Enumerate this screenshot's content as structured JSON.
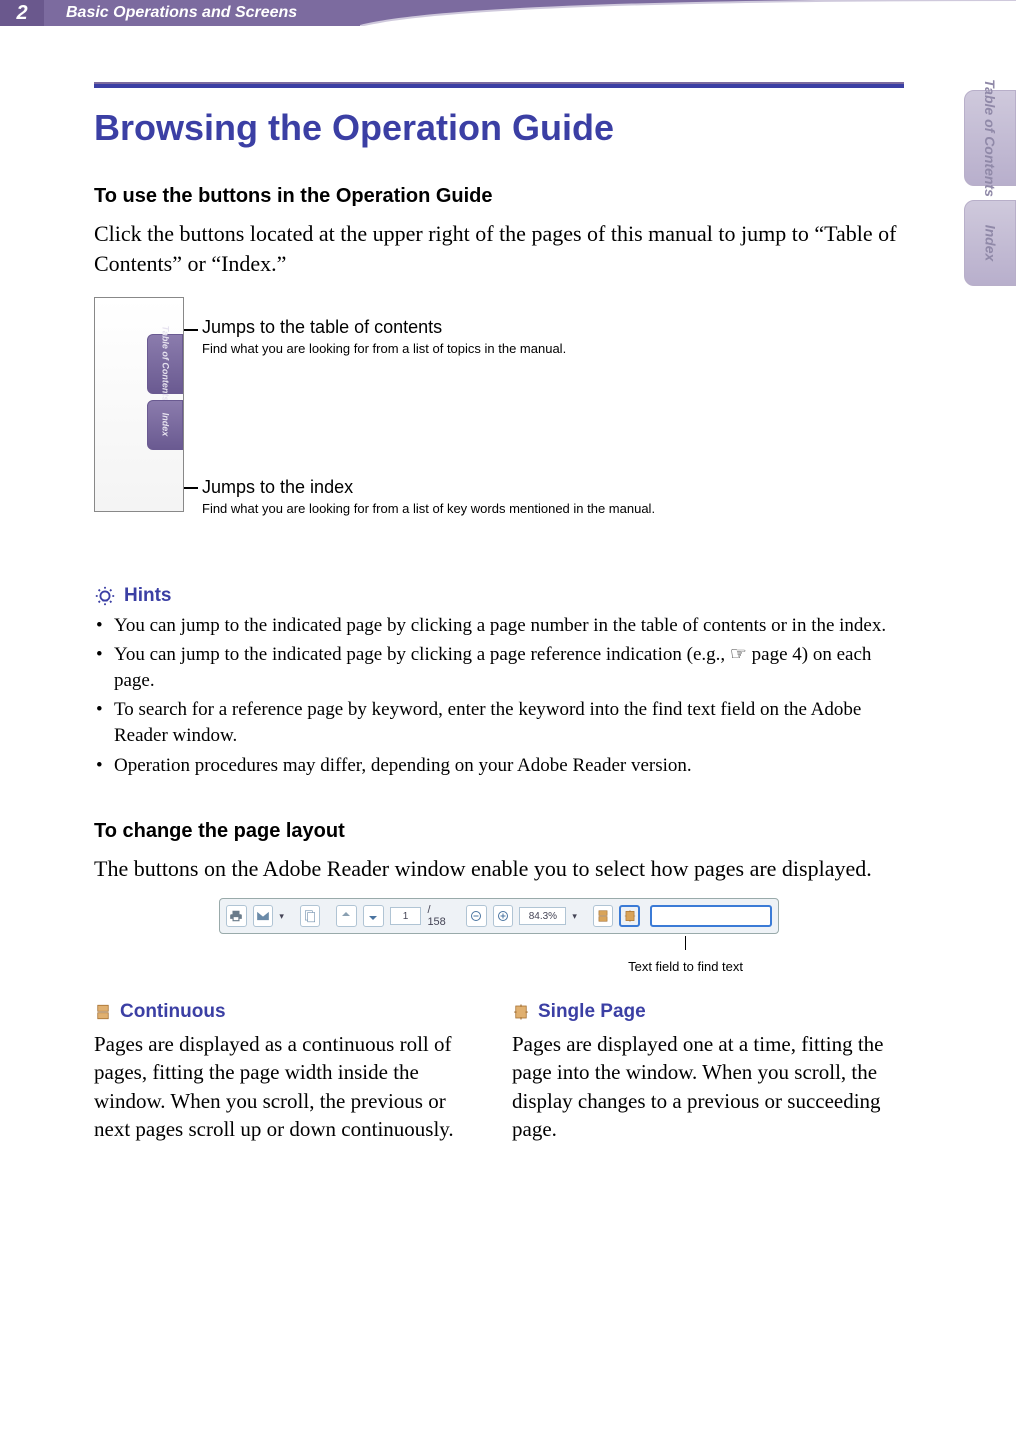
{
  "header": {
    "page_number": "2",
    "section": "Basic Operations and Screens"
  },
  "side_tabs": {
    "toc": "Table of\nContents",
    "index": "Index"
  },
  "main": {
    "title": "Browsing the Operation Guide",
    "sub1": "To use the buttons in the Operation Guide",
    "intro": "Click the buttons located at the upper right of the pages of this manual to jump to “Table of Contents” or “Index.”"
  },
  "diagram": {
    "mini_toc": "Table of\nContents",
    "mini_index": "Index",
    "toc_title": "Jumps to the table of contents",
    "toc_desc": "Find what you are looking for from a list of topics in the manual.",
    "index_title": "Jumps to the index",
    "index_desc": "Find what you are looking for from a list of key words mentioned in the manual."
  },
  "hints": {
    "heading": "Hints",
    "items": [
      "You can jump to the indicated page by clicking a page number in the table of contents or in the index.",
      "You can jump to the indicated page by clicking a page reference indication (e.g., ☞ page 4) on each page.",
      "To search for a reference page by keyword, enter the keyword into the find text field on the Adobe Reader window.",
      "Operation procedures may differ, depending on your Adobe Reader version."
    ]
  },
  "layout": {
    "sub2": "To change the page layout",
    "intro2": "The buttons on the Adobe Reader window enable you to select how pages are displayed."
  },
  "toolbar": {
    "page_current": "1",
    "page_total": "/ 158",
    "zoom": "84.3%",
    "find_caption": "Text field to find text"
  },
  "columns": {
    "continuous": {
      "title": "Continuous",
      "body": "Pages are displayed as a continuous roll of pages, fitting the page width inside the window. When you scroll, the previous or next pages scroll up or down continuously."
    },
    "single": {
      "title": "Single Page",
      "body": "Pages are displayed one at a time, fitting the page into the window. When you scroll, the display changes to a previous or succeeding page."
    }
  }
}
